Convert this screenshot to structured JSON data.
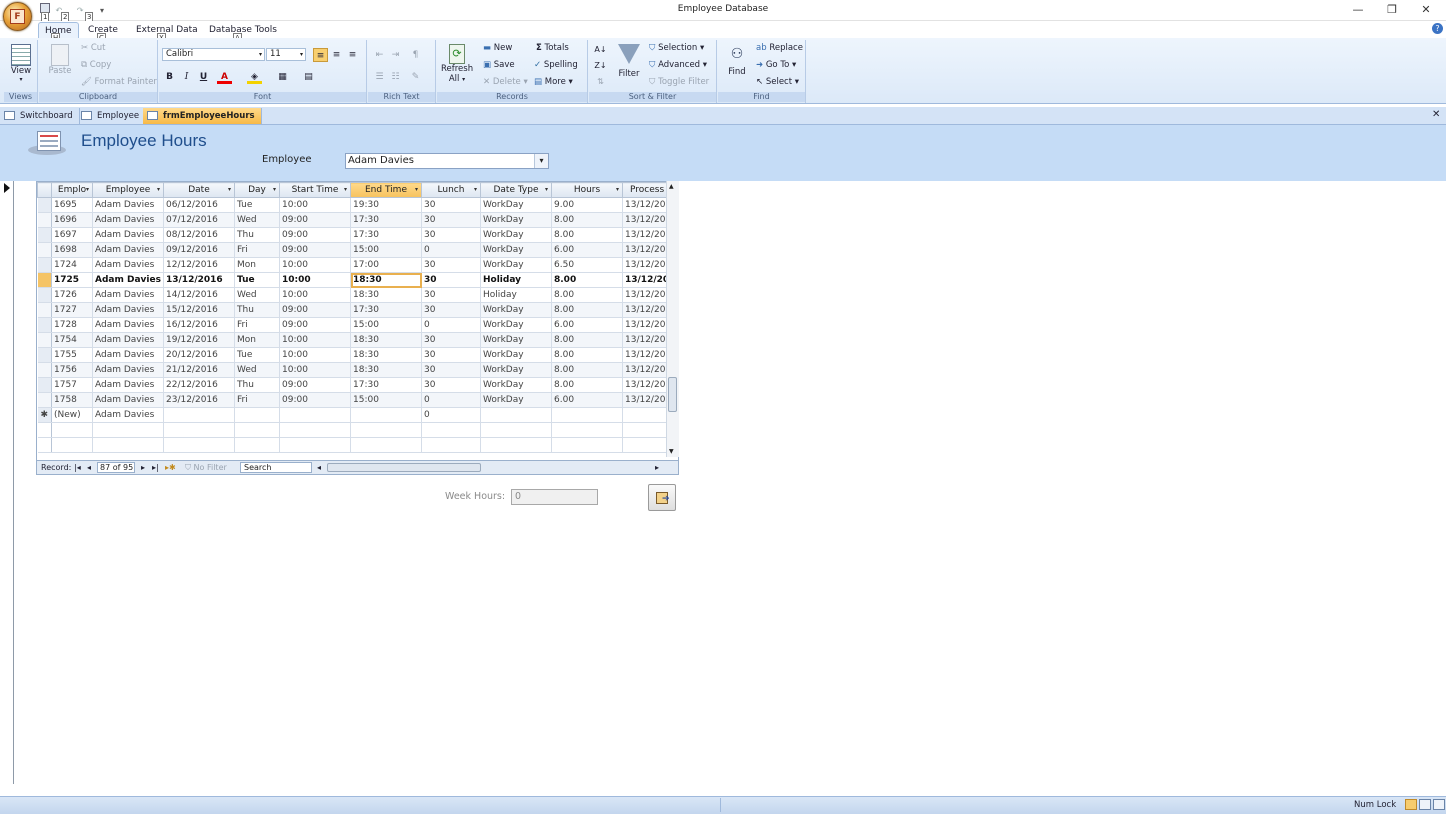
{
  "window": {
    "title": "Employee Database",
    "minimize": "—",
    "restore": "❐",
    "close": "✕"
  },
  "office_button": {
    "letter": "F"
  },
  "keytips": {
    "qat": [
      "1",
      "2",
      "3"
    ],
    "home": "H",
    "create": "C",
    "external": "X",
    "dbtools": "A"
  },
  "ribbon_tabs": [
    "Home",
    "Create",
    "External Data",
    "Database Tools"
  ],
  "ribbon": {
    "views": {
      "view": "View",
      "group": "Views"
    },
    "clipboard": {
      "paste": "Paste",
      "cut": "Cut",
      "copy": "Copy",
      "format_painter": "Format Painter",
      "group": "Clipboard"
    },
    "font": {
      "font_name": "Calibri",
      "font_size": "11",
      "bold": "B",
      "italic": "I",
      "underline": "U",
      "group": "Font"
    },
    "rich_text": {
      "group": "Rich Text"
    },
    "records": {
      "refresh": "Refresh",
      "refresh_sub": "All",
      "new": "New",
      "save": "Save",
      "delete": "Delete",
      "totals": "Totals",
      "spelling": "Spelling",
      "more": "More",
      "group": "Records"
    },
    "sort_filter": {
      "filter": "Filter",
      "selection": "Selection",
      "advanced": "Advanced",
      "toggle_filter": "Toggle Filter",
      "group": "Sort & Filter"
    },
    "find": {
      "find": "Find",
      "replace": "Replace",
      "goto": "Go To",
      "select": "Select",
      "group": "Find"
    }
  },
  "doc_tabs": [
    "Switchboard",
    "Employee",
    "frmEmployeeHours"
  ],
  "form": {
    "title": "Employee Hours",
    "employee_label": "Employee",
    "employee_value": "Adam Davies"
  },
  "datasheet": {
    "columns": [
      "Emplo",
      "Employee",
      "Date",
      "Day",
      "Start Time",
      "End Time",
      "Lunch",
      "Date Type",
      "Hours",
      "Process"
    ],
    "rows": [
      [
        "1695",
        "Adam Davies",
        "06/12/2016",
        "Tue",
        "10:00",
        "19:30",
        "30",
        "WorkDay",
        "9.00",
        "13/12/20"
      ],
      [
        "1696",
        "Adam Davies",
        "07/12/2016",
        "Wed",
        "09:00",
        "17:30",
        "30",
        "WorkDay",
        "8.00",
        "13/12/20"
      ],
      [
        "1697",
        "Adam Davies",
        "08/12/2016",
        "Thu",
        "09:00",
        "17:30",
        "30",
        "WorkDay",
        "8.00",
        "13/12/20"
      ],
      [
        "1698",
        "Adam Davies",
        "09/12/2016",
        "Fri",
        "09:00",
        "15:00",
        "0",
        "WorkDay",
        "6.00",
        "13/12/20"
      ],
      [
        "1724",
        "Adam Davies",
        "12/12/2016",
        "Mon",
        "10:00",
        "17:00",
        "30",
        "WorkDay",
        "6.50",
        "13/12/20"
      ],
      [
        "1725",
        "Adam Davies",
        "13/12/2016",
        "Tue",
        "10:00",
        "18:30",
        "30",
        "Holiday",
        "8.00",
        "13/12/20"
      ],
      [
        "1726",
        "Adam Davies",
        "14/12/2016",
        "Wed",
        "10:00",
        "18:30",
        "30",
        "Holiday",
        "8.00",
        "13/12/20"
      ],
      [
        "1727",
        "Adam Davies",
        "15/12/2016",
        "Thu",
        "09:00",
        "17:30",
        "30",
        "WorkDay",
        "8.00",
        "13/12/20"
      ],
      [
        "1728",
        "Adam Davies",
        "16/12/2016",
        "Fri",
        "09:00",
        "15:00",
        "0",
        "WorkDay",
        "6.00",
        "13/12/20"
      ],
      [
        "1754",
        "Adam Davies",
        "19/12/2016",
        "Mon",
        "10:00",
        "18:30",
        "30",
        "WorkDay",
        "8.00",
        "13/12/20"
      ],
      [
        "1755",
        "Adam Davies",
        "20/12/2016",
        "Tue",
        "10:00",
        "18:30",
        "30",
        "WorkDay",
        "8.00",
        "13/12/20"
      ],
      [
        "1756",
        "Adam Davies",
        "21/12/2016",
        "Wed",
        "10:00",
        "18:30",
        "30",
        "WorkDay",
        "8.00",
        "13/12/20"
      ],
      [
        "1757",
        "Adam Davies",
        "22/12/2016",
        "Thu",
        "09:00",
        "17:30",
        "30",
        "WorkDay",
        "8.00",
        "13/12/20"
      ],
      [
        "1758",
        "Adam Davies",
        "23/12/2016",
        "Fri",
        "09:00",
        "15:00",
        "0",
        "WorkDay",
        "6.00",
        "13/12/20"
      ]
    ],
    "new_row": [
      "(New)",
      "Adam Davies",
      "",
      "",
      "",
      "",
      "0",
      "",
      "",
      ""
    ],
    "current_row_index": 5,
    "selected_column": "End Time"
  },
  "navbar": {
    "record_label": "Record:",
    "record_value": "87 of 95",
    "no_filter": "No Filter",
    "search": "Search"
  },
  "week_hours": {
    "label": "Week Hours:",
    "value": "0"
  },
  "status": {
    "num_lock": "Num Lock"
  },
  "colors": {
    "accent": "#f5c466",
    "header_bg": "#c5dcf6",
    "title_text": "#1f4e8c"
  }
}
